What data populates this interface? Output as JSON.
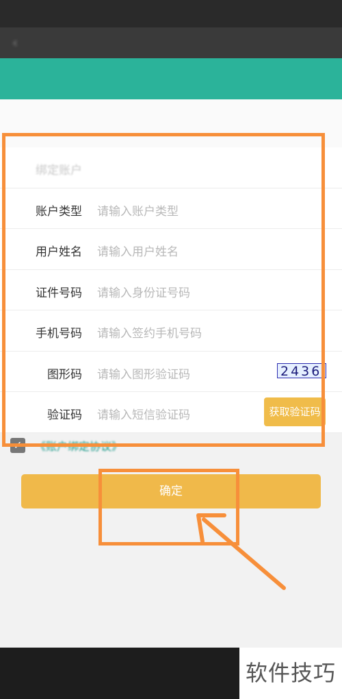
{
  "statusbar": {
    "left": "",
    "right": ""
  },
  "titlebar": {
    "title": ""
  },
  "form": {
    "rows": [
      {
        "label": "绑定账户",
        "placeholder": ""
      },
      {
        "label": "账户类型",
        "placeholder": "请输入账户类型"
      },
      {
        "label": "用户姓名",
        "placeholder": "请输入用户姓名"
      },
      {
        "label": "证件号码",
        "placeholder": "请输入身份证号码"
      },
      {
        "label": "手机号码",
        "placeholder": "请输入签约手机号码"
      },
      {
        "label": "图形码",
        "placeholder": "请输入图形验证码"
      },
      {
        "label": "验证码",
        "placeholder": "请输入短信验证码"
      }
    ],
    "captcha_text": "2436",
    "get_code_label": "获取验证码"
  },
  "agreement": {
    "checked": true,
    "link_text": "《账户绑定协议》"
  },
  "confirm_label": "确定",
  "watermark": "软件技巧",
  "colors": {
    "teal": "#2bb39a",
    "accent": "#f0b94a",
    "highlight": "#f78f3a"
  }
}
